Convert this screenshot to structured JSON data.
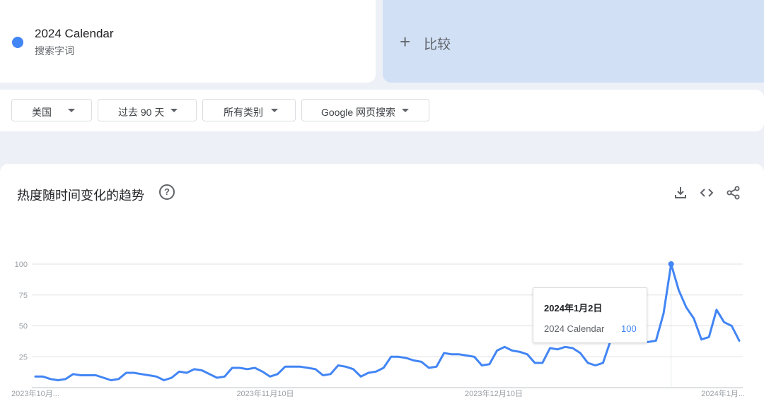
{
  "search_term": {
    "name": "2024 Calendar",
    "type": "搜索字词",
    "color": "#4285f4"
  },
  "compare": {
    "icon": "plus-icon",
    "plus": "+",
    "label": "比较"
  },
  "filters": [
    {
      "label": "美国"
    },
    {
      "label": "过去 90 天"
    },
    {
      "label": "所有类别"
    },
    {
      "label": "Google 网页搜索"
    }
  ],
  "chart_card": {
    "title": "热度随时间变化的趋势",
    "help_icon": "help-circle-icon",
    "help_glyph": "?",
    "actions": [
      "download-icon",
      "embed-code-icon",
      "share-icon"
    ]
  },
  "tooltip": {
    "date": "2024年1月2日",
    "term": "2024 Calendar",
    "value": "100"
  },
  "chart_data": {
    "type": "line",
    "series": [
      {
        "name": "2024 Calendar",
        "color": "#4285f4",
        "values": [
          9,
          9,
          7,
          6,
          7,
          11,
          10,
          10,
          10,
          8,
          6,
          7,
          12,
          12,
          11,
          10,
          9,
          6,
          8,
          13,
          12,
          15,
          14,
          11,
          8,
          9,
          16,
          16,
          15,
          16,
          13,
          9,
          11,
          17,
          17,
          17,
          16,
          15,
          10,
          11,
          18,
          17,
          15,
          9,
          12,
          13,
          16,
          25,
          25,
          24,
          22,
          21,
          16,
          17,
          28,
          27,
          27,
          26,
          25,
          18,
          19,
          30,
          33,
          30,
          29,
          27,
          20,
          20,
          32,
          31,
          33,
          32,
          28,
          20,
          18,
          20,
          38,
          47,
          51,
          43,
          37,
          37,
          38,
          60,
          100,
          79,
          65,
          56,
          39,
          41,
          63,
          53,
          50,
          38
        ]
      }
    ],
    "x_ticks": [
      "2023年10月...",
      "2023年11月10日",
      "2023年12月10日",
      "2024年1月..."
    ],
    "y_ticks": [
      25,
      50,
      75,
      100
    ],
    "ylim": [
      0,
      100
    ],
    "grid": true,
    "highlight_index": 84
  }
}
